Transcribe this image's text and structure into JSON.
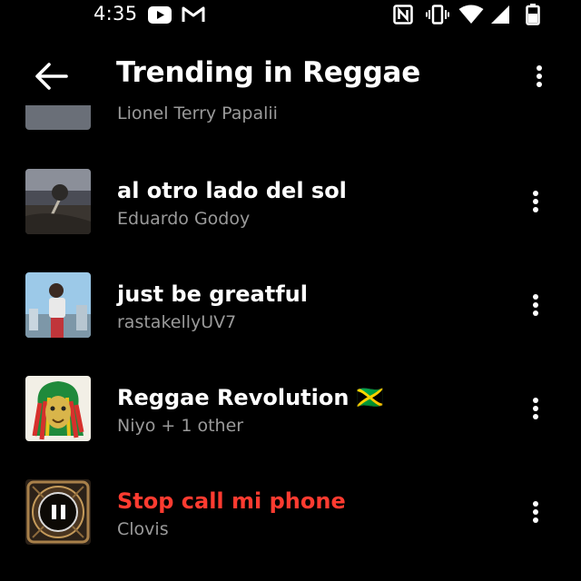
{
  "status_bar": {
    "time": "4:35",
    "icons": [
      "youtube-icon",
      "gmail-icon",
      "nfc-icon",
      "vibrate-icon",
      "wifi-icon",
      "cell-signal-icon",
      "battery-icon"
    ]
  },
  "header": {
    "title": "Trending in Reggae",
    "back_icon": "arrow-left-icon",
    "more_icon": "more-vert-icon"
  },
  "partial_item": {
    "artist": "Lionel Terry Papalii"
  },
  "tracks": [
    {
      "title": "al otro lado del sol",
      "artist": "Eduardo Godoy",
      "state": "idle"
    },
    {
      "title": "just be greatful",
      "artist": "rastakellyUV7",
      "state": "idle"
    },
    {
      "title": "Reggae Revolution 🇯🇲",
      "artist": "Niyo + 1 other",
      "state": "idle"
    },
    {
      "title": "Stop call mi phone",
      "artist": "Clovis",
      "state": "playing"
    }
  ],
  "colors": {
    "background": "#000000",
    "text_primary": "#ffffff",
    "text_secondary": "#9a9a9a",
    "playing_accent": "#ff3b30"
  }
}
